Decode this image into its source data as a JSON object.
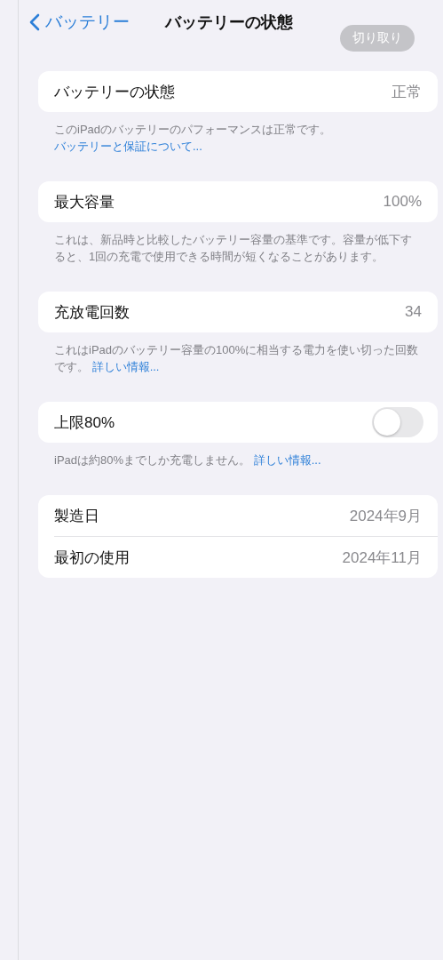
{
  "nav": {
    "back_label": "バッテリー",
    "title": "バッテリーの状態",
    "overlay_button": "切り取り"
  },
  "sections": [
    {
      "rows": [
        {
          "kind": "value",
          "label": "バッテリーの状態",
          "value": "正常"
        }
      ],
      "footer": {
        "text": "このiPadのバッテリーのパフォーマンスは正常です。",
        "link": "バッテリーと保証について..."
      }
    },
    {
      "rows": [
        {
          "kind": "value",
          "label": "最大容量",
          "value": "100%"
        }
      ],
      "footer": {
        "text": "これは、新品時と比較したバッテリー容量の基準です。容量が低下すると、1回の充電で使用できる時間が短くなることがあります。"
      }
    },
    {
      "rows": [
        {
          "kind": "value",
          "label": "充放電回数",
          "value": "34"
        }
      ],
      "footer": {
        "text": "これはiPadのバッテリー容量の100%に相当する電力を使い切った回数です。",
        "link": "詳しい情報..."
      }
    },
    {
      "rows": [
        {
          "kind": "toggle",
          "label": "上限80%",
          "on": false
        }
      ],
      "footer": {
        "text": "iPadは約80%までしか充電しません。",
        "link": "詳しい情報..."
      }
    },
    {
      "rows": [
        {
          "kind": "value",
          "label": "製造日",
          "value": "2024年9月"
        },
        {
          "kind": "value",
          "label": "最初の使用",
          "value": "2024年11月"
        }
      ]
    }
  ]
}
